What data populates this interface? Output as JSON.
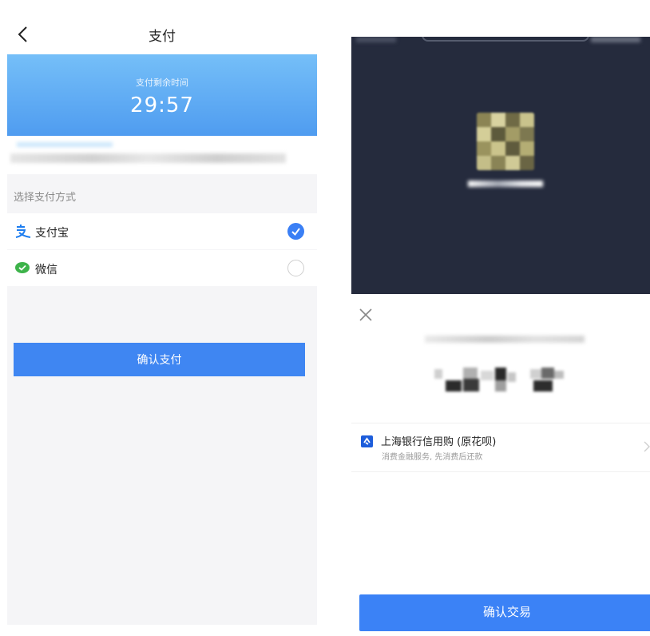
{
  "left_screen": {
    "nav": {
      "title": "支付",
      "back_icon": "chevron-left-icon"
    },
    "timer": {
      "label": "支付剩余时间",
      "value": "29:57"
    },
    "section_label": "选择支付方式",
    "payment_methods": [
      {
        "label": "支付宝",
        "icon": "alipay-icon",
        "selected": true
      },
      {
        "label": "微信",
        "icon": "wechat-icon",
        "selected": false
      }
    ],
    "confirm_label": "确认支付"
  },
  "right_screen": {
    "close_icon": "close-icon",
    "payment_option": {
      "title": "上海银行信用购 (原花呗)",
      "subtitle": "消费金融服务, 先消费后还款"
    },
    "confirm_label": "确认交易"
  },
  "colors": {
    "accent": "#3f86f2",
    "timer_top": "#75bff8",
    "timer_bottom": "#4f9cf0",
    "dark_panel": "#252b3d",
    "wechat_green": "#3db34a"
  }
}
